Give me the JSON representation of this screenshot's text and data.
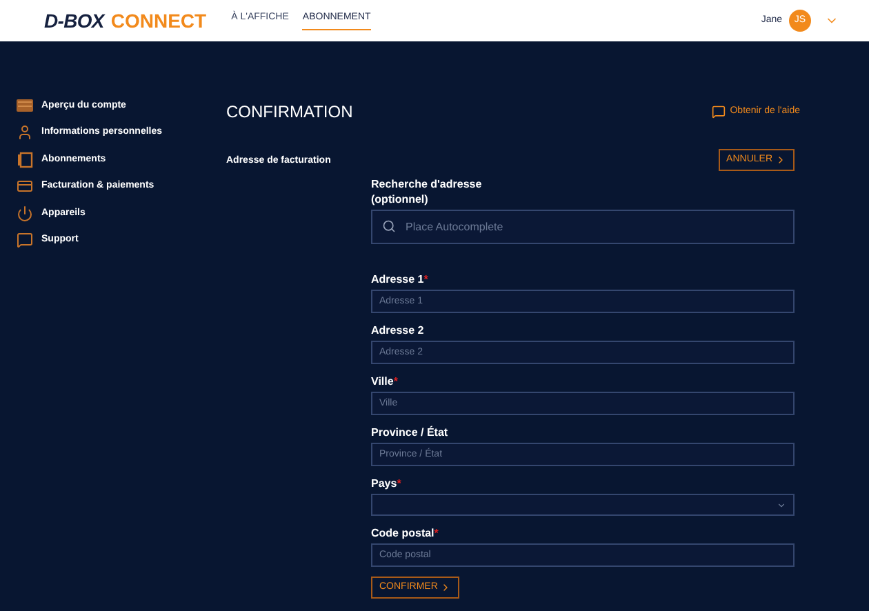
{
  "header": {
    "logo_primary": "D-BOX",
    "logo_secondary": "CONNECT",
    "nav": [
      {
        "label": "À L'AFFICHE",
        "selected": false
      },
      {
        "label": "ABONNEMENT",
        "selected": true
      }
    ],
    "user": {
      "name": "Jane",
      "initials": "JS"
    }
  },
  "sidebar": {
    "items": [
      {
        "label": "Aperçu du compte"
      },
      {
        "label": "Informations personnelles"
      },
      {
        "label": "Abonnements"
      },
      {
        "label": "Facturation & paiements"
      },
      {
        "label": "Appareils"
      },
      {
        "label": "Support"
      }
    ]
  },
  "page": {
    "title": "CONFIRMATION",
    "help_link": "Obtenir de l'aide",
    "section_label": "Adresse de facturation",
    "cancel_button": "ANNULER",
    "fields": [
      {
        "kind": "search",
        "label": "Recherche d'adresse (optionnel)",
        "placeholder": "Place Autocomplete"
      },
      {
        "kind": "text",
        "label": "Adresse 1",
        "required_mark": "*",
        "placeholder": "Adresse 1"
      },
      {
        "kind": "text",
        "label": "Adresse 2",
        "placeholder": "Adresse 2"
      },
      {
        "kind": "text",
        "label": "Ville",
        "required_mark": "*",
        "placeholder": "Ville"
      },
      {
        "kind": "text",
        "label": "Province / État",
        "placeholder": "Province / État"
      },
      {
        "kind": "select",
        "label": "Pays",
        "required_mark": "*"
      },
      {
        "kind": "text",
        "label": "Code postal",
        "required_mark": "*",
        "placeholder": "Code postal"
      }
    ],
    "confirm_button": "CONFIRMER"
  }
}
